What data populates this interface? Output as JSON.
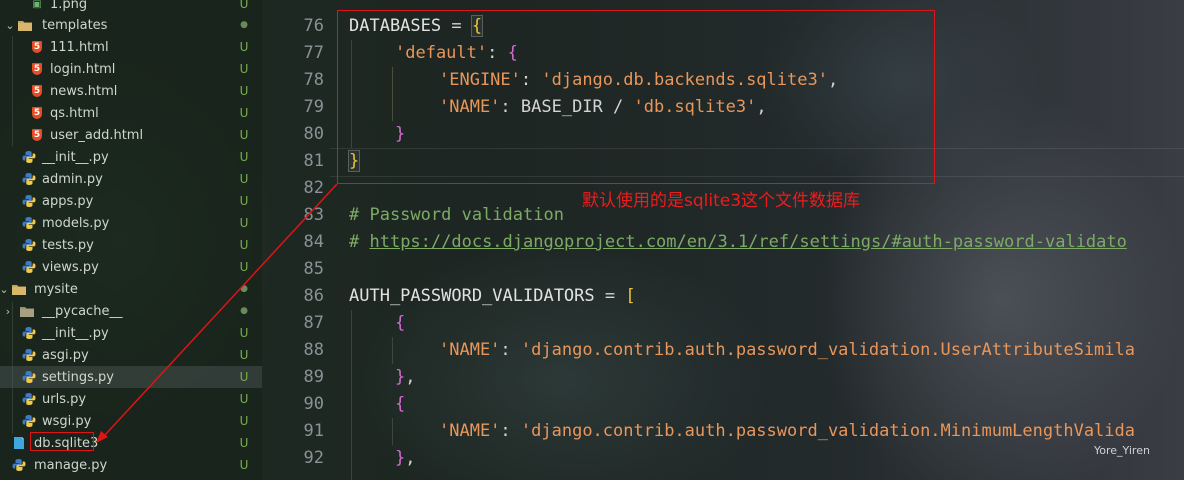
{
  "sidebar": {
    "rows": [
      {
        "label": "1.png",
        "icon": "image-icon",
        "status": "U"
      },
      {
        "label": "templates",
        "icon": "folder-icon",
        "status": "●"
      },
      {
        "label": "111.html",
        "icon": "html5-icon",
        "status": "U"
      },
      {
        "label": "login.html",
        "icon": "html5-icon",
        "status": "U"
      },
      {
        "label": "news.html",
        "icon": "html5-icon",
        "status": "U"
      },
      {
        "label": "qs.html",
        "icon": "html5-icon",
        "status": "U"
      },
      {
        "label": "user_add.html",
        "icon": "html5-icon",
        "status": "U"
      },
      {
        "label": "__init__.py",
        "icon": "python-icon",
        "status": "U"
      },
      {
        "label": "admin.py",
        "icon": "python-icon",
        "status": "U"
      },
      {
        "label": "apps.py",
        "icon": "python-icon",
        "status": "U"
      },
      {
        "label": "models.py",
        "icon": "python-icon",
        "status": "U"
      },
      {
        "label": "tests.py",
        "icon": "python-icon",
        "status": "U"
      },
      {
        "label": "views.py",
        "icon": "python-icon",
        "status": "U"
      },
      {
        "label": "mysite",
        "icon": "folder-icon",
        "status": "●"
      },
      {
        "label": "__pycache__",
        "icon": "folder-icon",
        "status": "●"
      },
      {
        "label": "__init__.py",
        "icon": "python-icon",
        "status": "U"
      },
      {
        "label": "asgi.py",
        "icon": "python-icon",
        "status": "U"
      },
      {
        "label": "settings.py",
        "icon": "python-icon",
        "status": "U"
      },
      {
        "label": "urls.py",
        "icon": "python-icon",
        "status": "U"
      },
      {
        "label": "wsgi.py",
        "icon": "python-icon",
        "status": "U"
      },
      {
        "label": "db.sqlite3",
        "icon": "database-icon",
        "status": "U"
      },
      {
        "label": "manage.py",
        "icon": "python-icon",
        "status": "U"
      }
    ]
  },
  "editor": {
    "line_numbers": [
      "76",
      "77",
      "78",
      "79",
      "80",
      "81",
      "82",
      "83",
      "84",
      "85",
      "86",
      "87",
      "88",
      "89",
      "90",
      "91",
      "92"
    ],
    "lines": {
      "l76": {
        "name": "DATABASES",
        "op": " = ",
        "brace": "{"
      },
      "l77": {
        "key": "'default'",
        "op": ": ",
        "brace": "{"
      },
      "l78": {
        "key": "'ENGINE'",
        "op": ": ",
        "val": "'django.db.backends.sqlite3'",
        "end": ","
      },
      "l79": {
        "key": "'NAME'",
        "op": ": BASE_DIR / ",
        "val": "'db.sqlite3'",
        "end": ","
      },
      "l80": {
        "brace": "}"
      },
      "l81": {
        "brace": "}"
      },
      "l83": {
        "comment": "# Password validation"
      },
      "l84": {
        "hash": "# ",
        "url": "https://docs.djangoproject.com/en/3.1/ref/settings/#auth-password-validato"
      },
      "l86": {
        "name": "AUTH_PASSWORD_VALIDATORS",
        "op": " = ",
        "brace": "["
      },
      "l87": {
        "brace": "{"
      },
      "l88": {
        "key": "'NAME'",
        "op": ": ",
        "val": "'django.contrib.auth.password_validation.UserAttributeSimila"
      },
      "l89": {
        "brace": "}",
        "end": ","
      },
      "l90": {
        "brace": "{"
      },
      "l91": {
        "key": "'NAME'",
        "op": ": ",
        "val": "'django.contrib.auth.password_validation.MinimumLengthValida"
      },
      "l92": {
        "brace": "}",
        "end": ","
      }
    }
  },
  "annotation": {
    "text": "默认使用的是sqlite3这个文件数据库"
  },
  "watermark": {
    "text": "Yore_Yiren"
  },
  "colors": {
    "accent_red": "#e01414",
    "string": "#e8965a",
    "comment": "#7cab66",
    "bracket_gold": "#e8c73a",
    "bracket_pink": "#d36bd1",
    "untracked": "#78b04a"
  }
}
